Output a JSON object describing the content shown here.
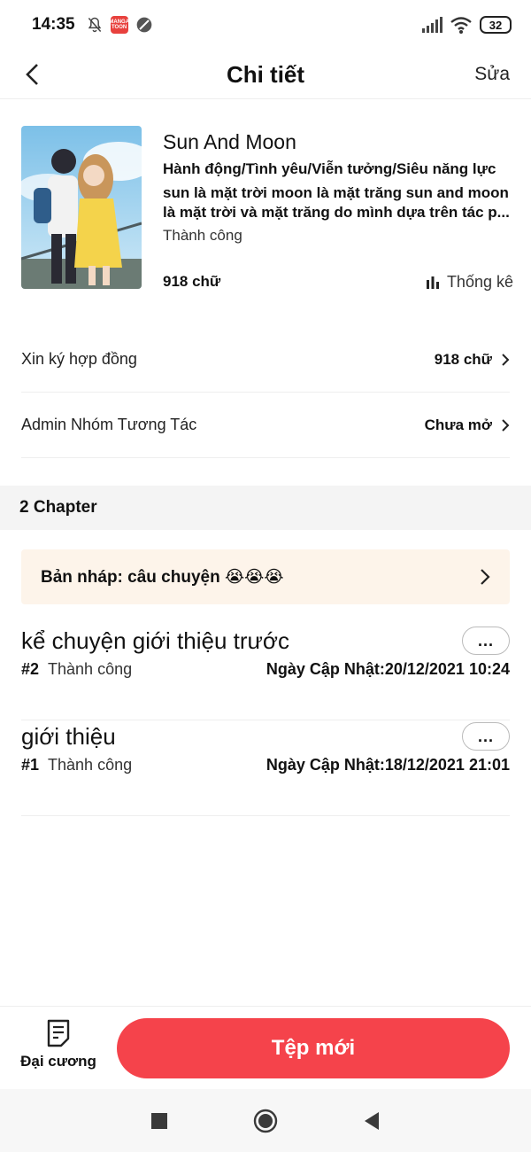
{
  "status_bar": {
    "time": "14:35",
    "app_badge": "MANGA TOON",
    "battery": "32"
  },
  "header": {
    "title": "Chi tiết",
    "edit_label": "Sửa"
  },
  "book": {
    "title": "Sun And Moon",
    "genres": "Hành động/Tình yêu/Viễn tưởng/Siêu năng lực",
    "description": "sun là mặt trời moon là mặt trăng sun and moon là mặt trời và mặt trăng do mình dựa trên tác p...",
    "status": "Thành công",
    "word_count": "918 chữ",
    "stats_label": "Thống kê"
  },
  "settings": [
    {
      "label": "Xin ký hợp đồng",
      "value": "918 chữ"
    },
    {
      "label": "Admin Nhóm Tương Tác",
      "value": "Chưa mở"
    }
  ],
  "chapters_header": "2 Chapter",
  "draft": {
    "label": "Bản nháp: câu chuyện 😭😭😭"
  },
  "chapters": [
    {
      "title": "kể chuyện giới thiệu trước",
      "number": "#2",
      "status": "Thành công",
      "updated": "Ngày Cập Nhật:20/12/2021 10:24",
      "more": "..."
    },
    {
      "title": "giới thiệu",
      "number": "#1",
      "status": "Thành công",
      "updated": "Ngày Cập Nhật:18/12/2021 21:01",
      "more": "..."
    }
  ],
  "bottom": {
    "outline_label": "Đại cương",
    "new_file_label": "Tệp mới"
  },
  "colors": {
    "accent": "#f5434b",
    "draft_bg": "#fdf4ea",
    "section_bg": "#f4f4f4"
  }
}
